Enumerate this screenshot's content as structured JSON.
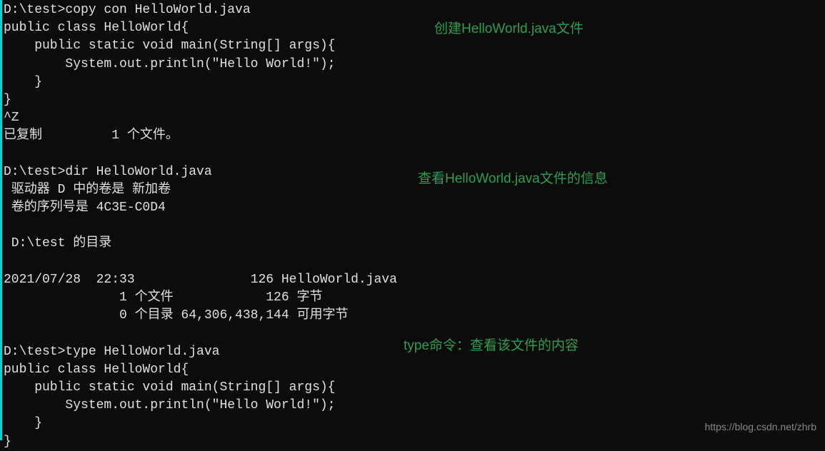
{
  "terminal": {
    "lines": [
      "D:\\test>copy con HelloWorld.java",
      "public class HelloWorld{",
      "    public static void main(String[] args){",
      "        System.out.println(\"Hello World!\");",
      "    }",
      "}",
      "^Z",
      "已复制         1 个文件。",
      "",
      "D:\\test>dir HelloWorld.java",
      " 驱动器 D 中的卷是 新加卷",
      " 卷的序列号是 4C3E-C0D4",
      "",
      " D:\\test 的目录",
      "",
      "2021/07/28  22:33               126 HelloWorld.java",
      "               1 个文件            126 字节",
      "               0 个目录 64,306,438,144 可用字节",
      "",
      "D:\\test>type HelloWorld.java",
      "public class HelloWorld{",
      "    public static void main(String[] args){",
      "        System.out.println(\"Hello World!\");",
      "    }",
      "}"
    ]
  },
  "annotations": {
    "note1": "创建HelloWorld.java文件",
    "note2": "查看HelloWorld.java文件的信息",
    "note3": "type命令：查看该文件的内容"
  },
  "watermark": "https://blog.csdn.net/zhrb"
}
